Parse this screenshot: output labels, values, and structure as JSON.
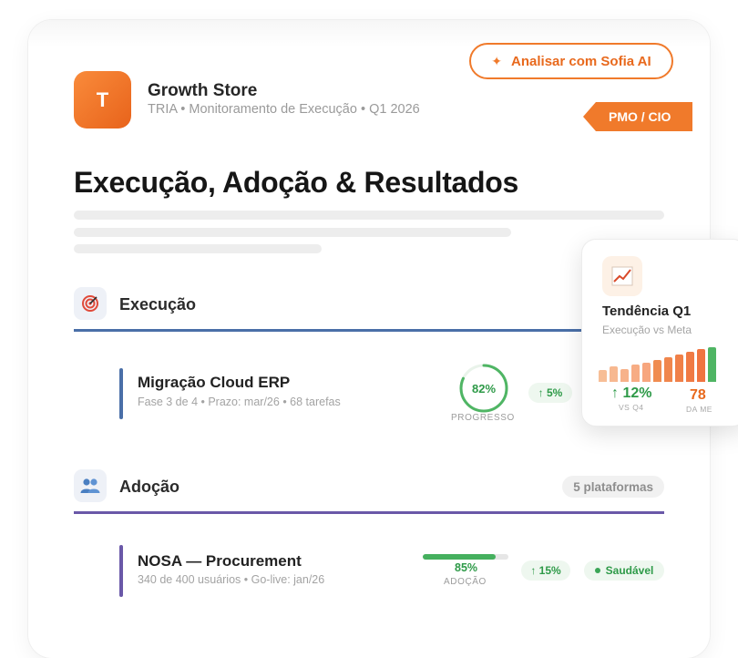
{
  "header": {
    "ai_button_label": "Analisar com Sofia AI",
    "logo_letter": "T",
    "company": "Growth Store",
    "subtitle": "TRIA • Monitoramento de Execução • Q1 2026",
    "role_tag": "PMO / CIO",
    "page_title": "Execução, Adoção & Resultados"
  },
  "sections": {
    "execucao": {
      "icon": "target-icon",
      "title": "Execução",
      "accent": "#4a6fa8",
      "item": {
        "title": "Migração Cloud ERP",
        "meta": "Fase 3 de 4 • Prazo: mar/26 • 68 tarefas",
        "progress_value": "82%",
        "progress_fraction": 0.82,
        "progress_caption": "PROGRESSO",
        "delta": "↑ 5%"
      }
    },
    "adocao": {
      "icon": "users-icon",
      "title": "Adoção",
      "count": "5 plataformas",
      "accent": "#6a58a8",
      "item": {
        "title": "NOSA — Procurement",
        "meta": "340 de 400 usuários • Go-live: jan/26",
        "adoption_value": "85%",
        "adoption_fraction": 0.85,
        "adoption_caption": "ADOÇÃO",
        "delta": "↑ 15%",
        "status": "Saudável"
      }
    }
  },
  "trend_card": {
    "icon": "chart-trend-icon",
    "title": "Tendência Q1",
    "subtitle": "Execução vs Meta",
    "stat1_value": "↑ 12%",
    "stat1_caption": "VS Q4",
    "stat2_value": "78",
    "stat2_caption": "DA ME",
    "bar_levels": [
      0.35,
      0.45,
      0.38,
      0.5,
      0.55,
      0.62,
      0.7,
      0.8,
      0.88,
      0.95,
      1.0
    ]
  },
  "colors": {
    "accent_orange": "#f07a2b",
    "success_green": "#2e9a48"
  }
}
